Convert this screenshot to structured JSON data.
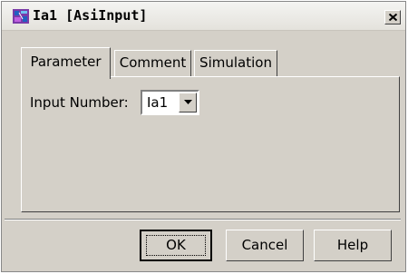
{
  "window": {
    "title": "Ia1 [AsiInput]",
    "icon": "asi-input-icon",
    "close_icon": "close-icon"
  },
  "tabs": [
    {
      "label": "Parameter",
      "active": true
    },
    {
      "label": "Comment",
      "active": false
    },
    {
      "label": "Simulation",
      "active": false
    }
  ],
  "parameter": {
    "input_number_label": "Input Number:",
    "input_number_value": "Ia1"
  },
  "buttons": {
    "ok": "OK",
    "cancel": "Cancel",
    "help": "Help"
  },
  "colors": {
    "face": "#d4d0c8",
    "icon_purple": "#7a3ba8",
    "icon_blue": "#2060c0"
  }
}
